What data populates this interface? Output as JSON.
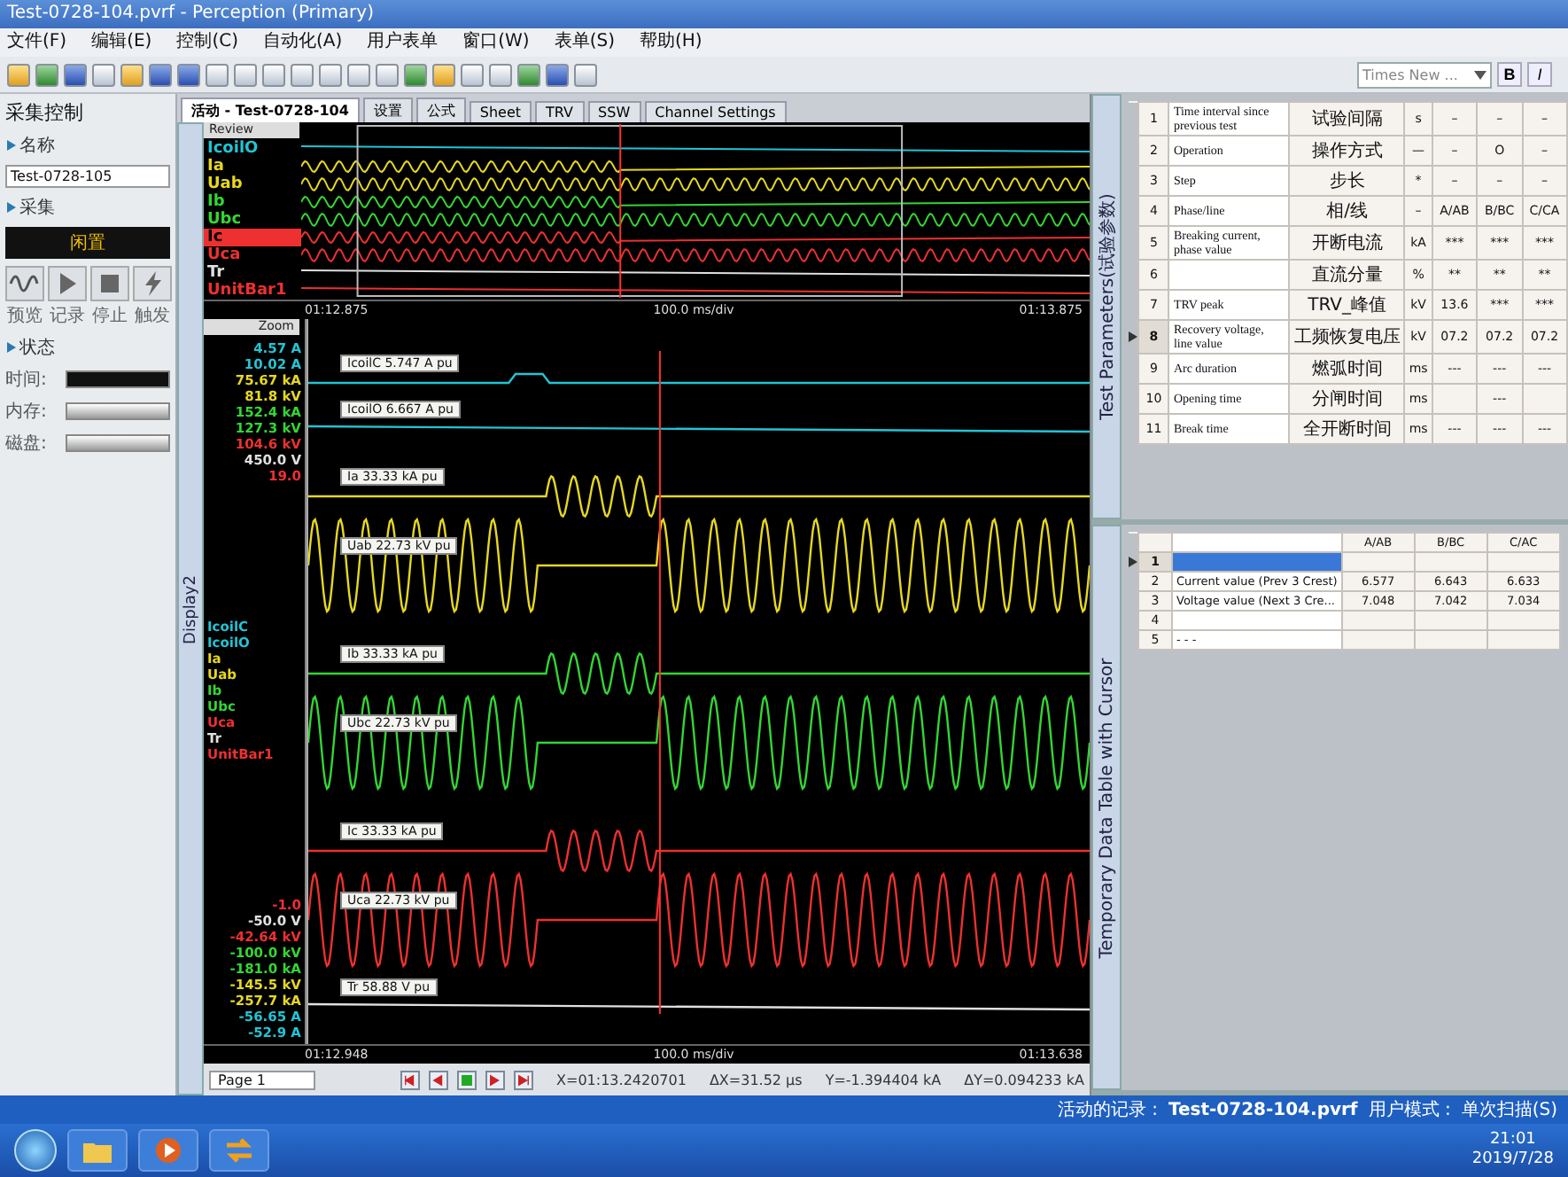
{
  "window": {
    "title": "Test-0728-104.pvrf - Perception (Primary)"
  },
  "menu": [
    "文件(F)",
    "编辑(E)",
    "控制(C)",
    "自动化(A)",
    "用户表单",
    "窗口(W)",
    "表单(S)",
    "帮助(H)"
  ],
  "toolbar": {
    "font": "Times New ...",
    "bold": "B",
    "italic": "I"
  },
  "acquisition_panel": {
    "title": "采集控制",
    "name_label": "名称",
    "name_value": "Test-0728-105",
    "acq_label": "采集",
    "acq_state": "闲置",
    "buttons": [
      {
        "label": "预览",
        "kind": "wave"
      },
      {
        "label": "记录",
        "kind": "play"
      },
      {
        "label": "停止",
        "kind": "stop"
      },
      {
        "label": "触发",
        "kind": "trigger"
      }
    ],
    "status_label": "状态",
    "status_rows": [
      {
        "label": "时间:",
        "kind": "dark"
      },
      {
        "label": "内存:",
        "kind": "bar"
      },
      {
        "label": "磁盘:",
        "kind": "bar"
      }
    ]
  },
  "tabs": [
    {
      "label": "活动 - Test-0728-104",
      "selected": true
    },
    {
      "label": "设置",
      "selected": false
    },
    {
      "label": "公式",
      "selected": false
    },
    {
      "label": "Sheet",
      "selected": false
    },
    {
      "label": "TRV",
      "selected": false
    },
    {
      "label": "SSW",
      "selected": false
    },
    {
      "label": "Channel Settings",
      "selected": false
    }
  ],
  "display": {
    "side_label": "Display2",
    "review": {
      "label": "Review",
      "start": "01:12.875",
      "scale": "100.0 ms/div",
      "end": "01:13.875",
      "channels": [
        {
          "name": "IcoilO",
          "color": "#22c4d4",
          "selected": false,
          "kind": "flat"
        },
        {
          "name": "Ia",
          "color": "#e6d820",
          "selected": false,
          "kind": "burst"
        },
        {
          "name": "Uab",
          "color": "#e6d820",
          "selected": false,
          "kind": "sine"
        },
        {
          "name": "Ib",
          "color": "#33d633",
          "selected": false,
          "kind": "burst"
        },
        {
          "name": "Ubc",
          "color": "#33d633",
          "selected": false,
          "kind": "sine"
        },
        {
          "name": "Ic",
          "color": "#ee3030",
          "selected": true,
          "kind": "burst"
        },
        {
          "name": "Uca",
          "color": "#ee3030",
          "selected": false,
          "kind": "sine"
        },
        {
          "name": "Tr",
          "color": "#e0e0e0",
          "selected": false,
          "kind": "flat"
        },
        {
          "name": "UnitBar1",
          "color": "#ee3030",
          "selected": false,
          "kind": "flat"
        }
      ]
    },
    "zoom": {
      "label": "Zoom",
      "start": "01:12.948",
      "scale": "100.0 ms/div",
      "end": "01:13.638",
      "scale_top": [
        {
          "text": "4.57 A",
          "color": "#22c4d4"
        },
        {
          "text": "10.02 A",
          "color": "#22c4d4"
        },
        {
          "text": "75.67 kA",
          "color": "#e6d820"
        },
        {
          "text": "81.8 kV",
          "color": "#e6d820"
        },
        {
          "text": "152.4 kA",
          "color": "#33d633"
        },
        {
          "text": "127.3 kV",
          "color": "#33d633"
        },
        {
          "text": "104.6 kV",
          "color": "#ee3030"
        },
        {
          "text": "450.0 V",
          "color": "#e0e0e0"
        },
        {
          "text": "19.0",
          "color": "#ee3030"
        }
      ],
      "channels": [
        {
          "name": "IcoilC",
          "color": "#22c4d4"
        },
        {
          "name": "IcoilO",
          "color": "#22c4d4"
        },
        {
          "name": "Ia",
          "color": "#e6d820"
        },
        {
          "name": "Uab",
          "color": "#e6d820"
        },
        {
          "name": "Ib",
          "color": "#33d633"
        },
        {
          "name": "Ubc",
          "color": "#33d633"
        },
        {
          "name": "Uca",
          "color": "#ee3030"
        },
        {
          "name": "Tr",
          "color": "#e0e0e0"
        },
        {
          "name": "UnitBar1",
          "color": "#ee3030"
        }
      ],
      "scale_bottom": [
        {
          "text": "-1.0",
          "color": "#ee3030"
        },
        {
          "text": "-50.0 V",
          "color": "#e0e0e0"
        },
        {
          "text": "-42.64 kV",
          "color": "#ee3030"
        },
        {
          "text": "-100.0 kV",
          "color": "#33d633"
        },
        {
          "text": "-181.0 kA",
          "color": "#33d633"
        },
        {
          "text": "-145.5 kV",
          "color": "#e6d820"
        },
        {
          "text": "-257.7 kA",
          "color": "#e6d820"
        },
        {
          "text": "-56.65 A",
          "color": "#22c4d4"
        },
        {
          "text": "-52.9 A",
          "color": "#22c4d4"
        }
      ],
      "traces": [
        {
          "label": "IcoilC 5.747 A pu",
          "color": "#22c4d4",
          "kind": "step"
        },
        {
          "label": "IcoilO 6.667 A pu",
          "color": "#22c4d4",
          "kind": "flat"
        },
        {
          "label": "Ia 33.33 kA pu",
          "color": "#e6d820",
          "kind": "burst"
        },
        {
          "label": "Uab 22.73 kV pu",
          "color": "#e6d820",
          "kind": "sine"
        },
        {
          "label": "Ib 33.33 kA pu",
          "color": "#33d633",
          "kind": "burst"
        },
        {
          "label": "Ubc 22.73 kV pu",
          "color": "#33d633",
          "kind": "sine"
        },
        {
          "label": "Ic 33.33 kA pu",
          "color": "#ee3030",
          "kind": "burst"
        },
        {
          "label": "Uca 22.73 kV pu",
          "color": "#ee3030",
          "kind": "sine"
        },
        {
          "label": "Tr 58.88 V pu",
          "color": "#e0e0e0",
          "kind": "flat"
        }
      ]
    },
    "footer": {
      "page": "Page 1",
      "x": "X=01:13.2420701",
      "dx": "ΔX=31.52 µs",
      "y": "Y=-1.394404 kA",
      "dy": "ΔY=0.094233 kA"
    }
  },
  "test_parameters": {
    "title": "Test Parameters(试验参数)",
    "rows": [
      {
        "num": "1",
        "name": "Time interval since previous test",
        "cn": "试验间隔",
        "unit": "s",
        "a": "–",
        "b": "–",
        "c": "–",
        "selected": false
      },
      {
        "num": "2",
        "name": "Operation",
        "cn": "操作方式",
        "unit": "—",
        "a": "–",
        "b": "O",
        "c": "–",
        "selected": false
      },
      {
        "num": "3",
        "name": "Step",
        "cn": "步长",
        "unit": "*",
        "a": "–",
        "b": "–",
        "c": "–",
        "selected": false
      },
      {
        "num": "4",
        "name": "Phase/line",
        "cn": "相/线",
        "unit": "–",
        "a": "A/AB",
        "b": "B/BC",
        "c": "C/CA",
        "selected": false
      },
      {
        "num": "5",
        "name": "Breaking current, phase value",
        "cn": "开断电流",
        "unit": "kA",
        "a": "***",
        "b": "***",
        "c": "***",
        "selected": false
      },
      {
        "num": "6",
        "cn": "直流分量",
        "unit": "%",
        "a": "**",
        "b": "**",
        "c": "**",
        "selected": false
      },
      {
        "num": "7",
        "name": "TRV peak",
        "cn": "TRV_峰值",
        "unit": "kV",
        "a": "13.6",
        "b": "***",
        "c": "***",
        "selected": false
      },
      {
        "num": "8",
        "name": "Recovery voltage, line value",
        "cn": "工频恢复电压",
        "unit": "kV",
        "a": "07.2",
        "b": "07.2",
        "c": "07.2",
        "selected": true
      },
      {
        "num": "9",
        "name": "Arc duration",
        "cn": "燃弧时间",
        "unit": "ms",
        "a": "---",
        "b": "---",
        "c": "---",
        "selected": false
      },
      {
        "num": "10",
        "name": "Opening time",
        "cn": "分闸时间",
        "unit": "ms",
        "b": "---",
        "selected": false
      },
      {
        "num": "11",
        "name": "Break time",
        "cn": "全开断时间",
        "unit": "ms",
        "a": "---",
        "b": "---",
        "c": "---",
        "selected": false
      }
    ]
  },
  "cursor_table": {
    "title": "Temporary Data Table with Cursor",
    "columns": [
      "A/AB",
      "B/BC",
      "C/AC"
    ],
    "rows": [
      {
        "num": "1",
        "selected": true
      },
      {
        "num": "2",
        "label": "Current value (Prev 3 Crest)",
        "values": [
          "6.577",
          "6.643",
          "6.633"
        ],
        "selected": false
      },
      {
        "num": "3",
        "label": "Voltage value  (Next 3 Cre...",
        "values": [
          "7.048",
          "7.042",
          "7.034"
        ],
        "selected": false
      },
      {
        "num": "4",
        "selected": false
      },
      {
        "num": "5",
        "label": "- - -",
        "selected": false
      }
    ]
  },
  "status_bar": {
    "record_label": "活动的记录 :",
    "record": "Test-0728-104.pvrf",
    "mode_label": "用户模式 :",
    "mode": "单次扫描(S)"
  },
  "taskbar": {
    "time": "21:01",
    "date": "2019/7/28"
  }
}
